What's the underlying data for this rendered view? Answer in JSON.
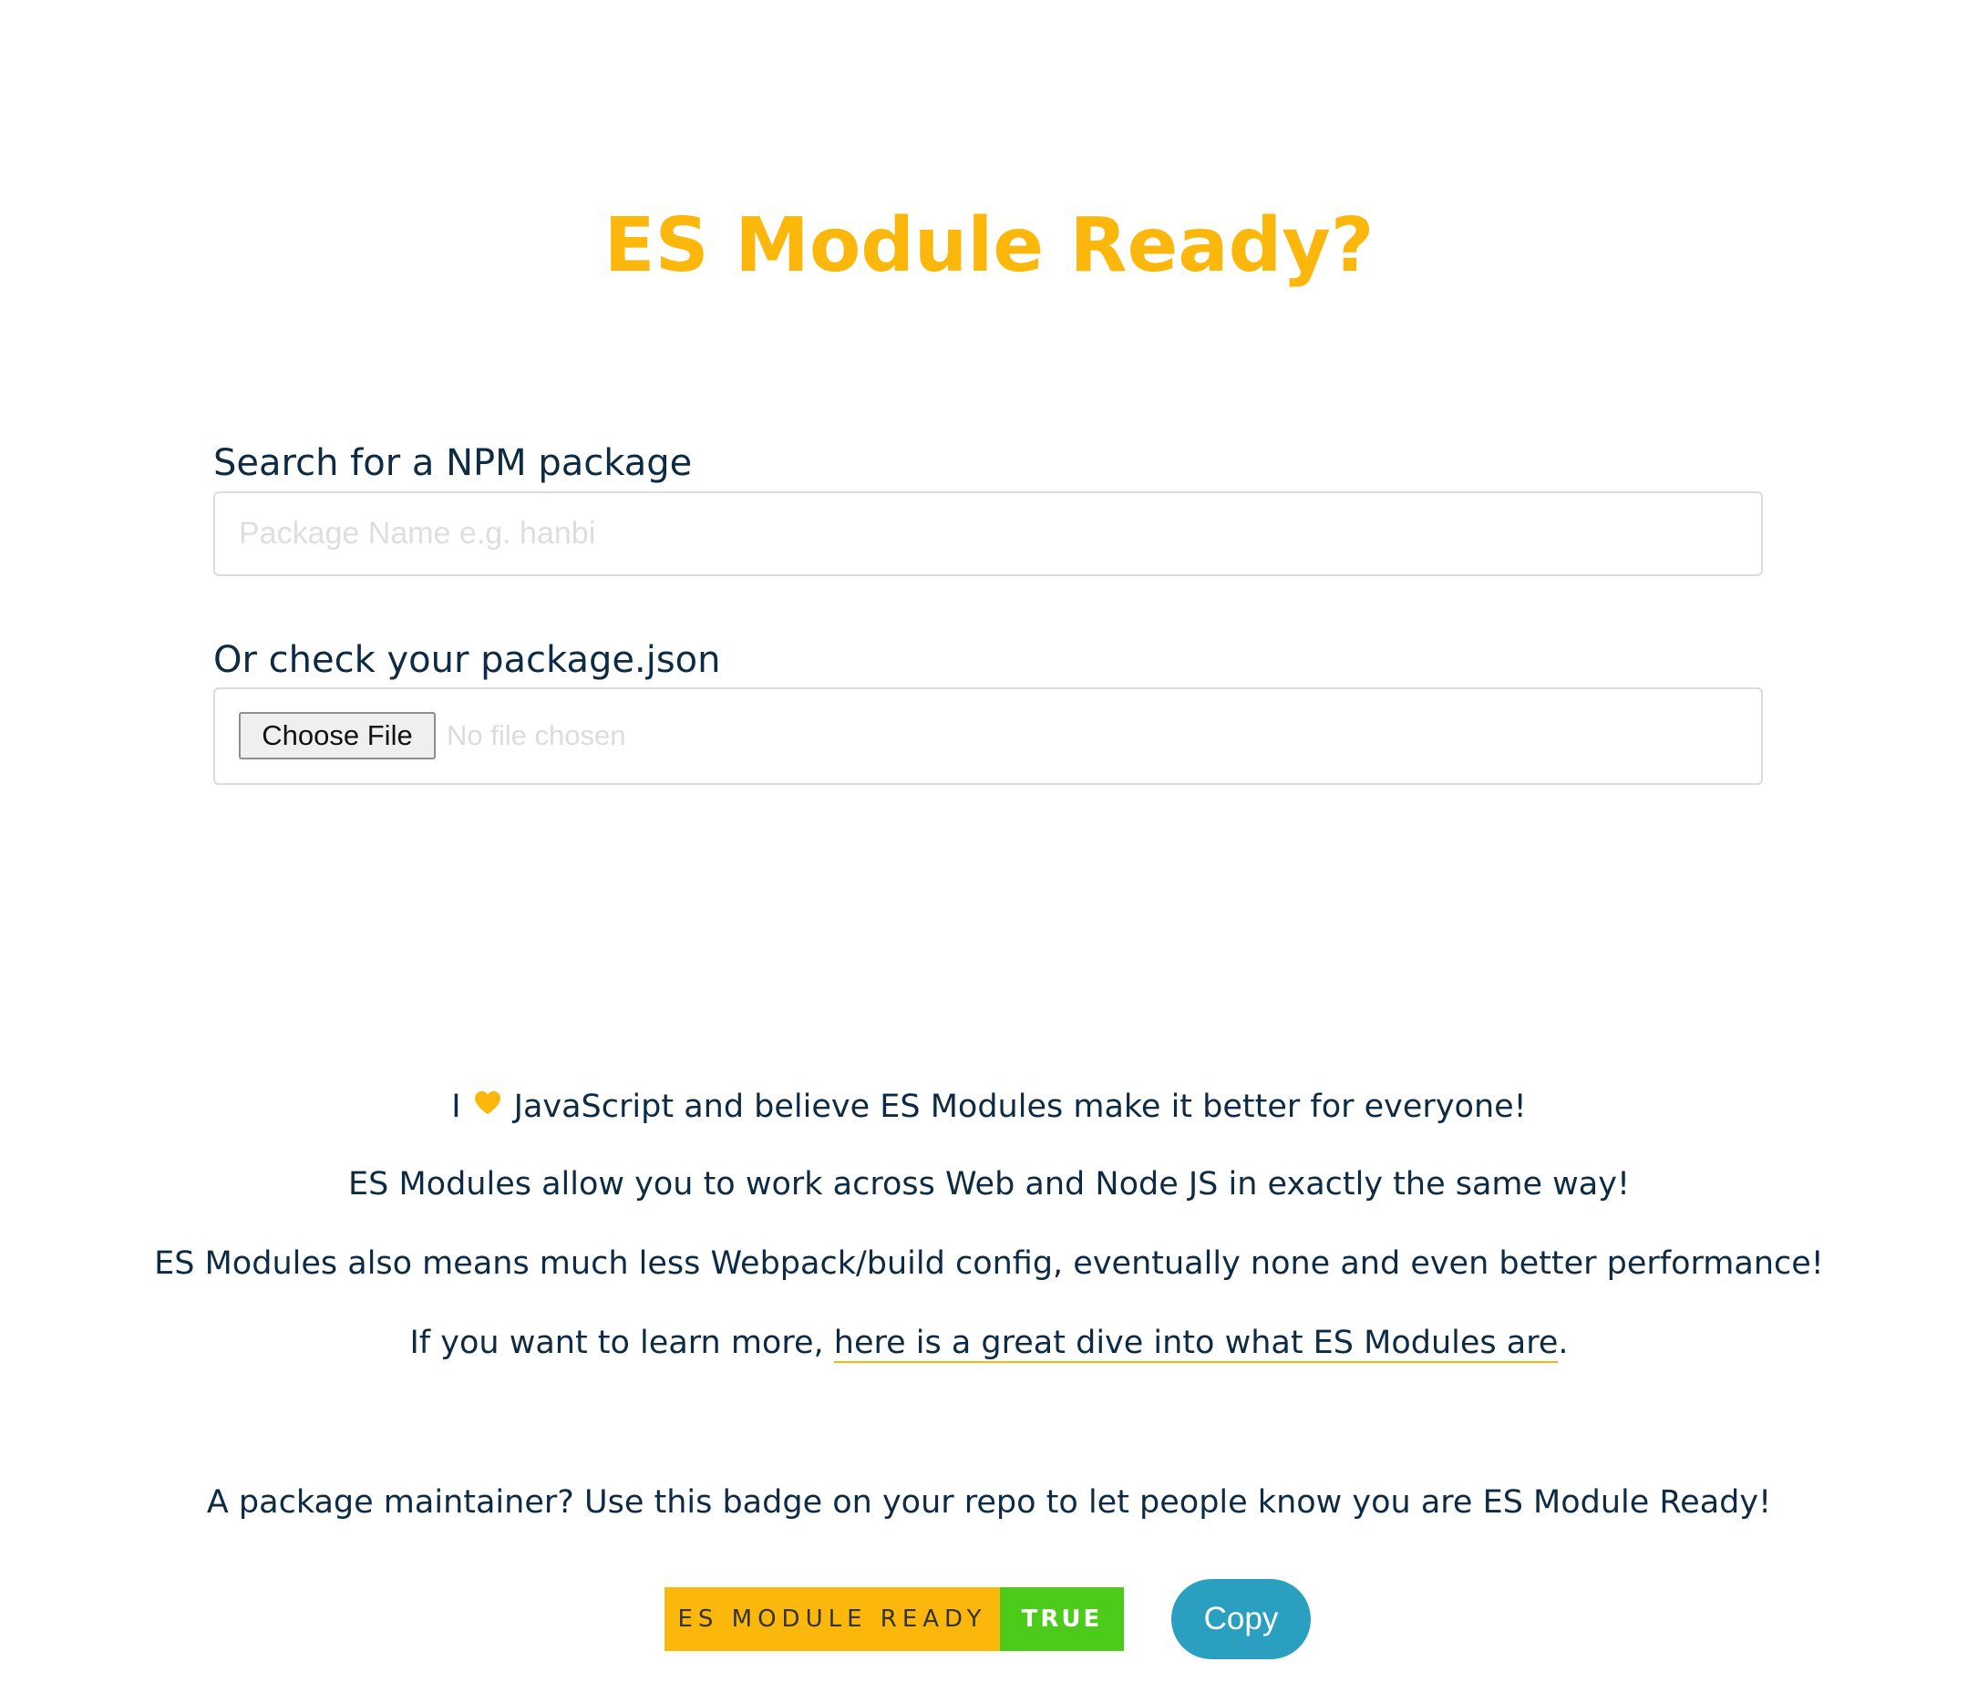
{
  "header": {
    "title": "ES Module Ready?"
  },
  "search": {
    "label": "Search for a NPM package",
    "placeholder": "Package Name e.g. hanbi",
    "value": ""
  },
  "file_upload": {
    "label": "Or check your package.json",
    "button_label": "Choose File",
    "status_text": "No file chosen"
  },
  "info": {
    "line1_prefix": "I",
    "line1_icon": "heart-icon",
    "line1_suffix": "JavaScript and believe ES Modules make it better for everyone!",
    "line2": "ES Modules allow you to work across Web and Node JS in exactly the same way!",
    "line3": "ES Modules also means much less Webpack/build config, eventually none and even better performance!",
    "line4_prefix": "If you want to learn more,",
    "line4_link": "here is a great dive into what ES Modules are",
    "line4_suffix": "."
  },
  "badge_section": {
    "text": "A package maintainer? Use this badge on your repo to let people know you are ES Module Ready!",
    "badge_label": "ES MODULE READY",
    "badge_value": "TRUE",
    "copy_label": "Copy"
  },
  "colors": {
    "accent": "#fbb70b",
    "text": "#0d2b45",
    "badge_green": "#4ccb1b",
    "copy_button": "#2a9fc0"
  }
}
